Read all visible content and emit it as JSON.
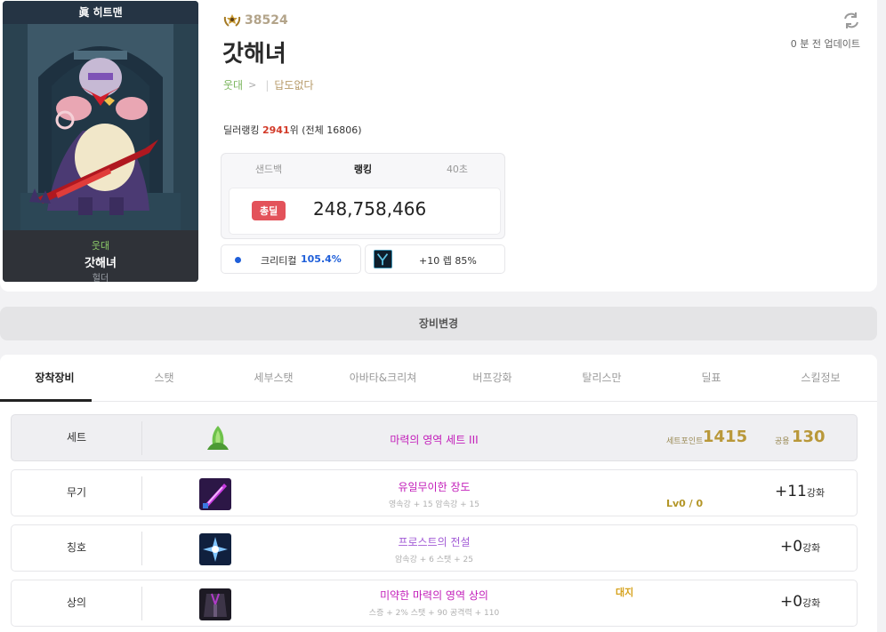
{
  "portrait": {
    "top_badge": "眞 히트맨",
    "adventure": "웃대",
    "name": "갓해녀",
    "job": "헐더"
  },
  "profile": {
    "fame": "38524",
    "name": "갓해녀",
    "adventure": "웃대",
    "guild": "답도없다",
    "update_text": "0 분 전 업데이트",
    "rank_label": "딜러랭킹",
    "rank_value": "2941",
    "rank_suffix": "위 (전체 16806)"
  },
  "stats": {
    "tabs": [
      "샌드백",
      "랭킹",
      "40초"
    ],
    "active_tab": "랭킹",
    "total_badge": "총딜",
    "total_damage": "248,758,466",
    "crit_label": "크리티컬",
    "crit_value": "105.4%",
    "weapon_level": "+10 렙 85%"
  },
  "gear_change_label": "장비변경",
  "main_tabs": [
    "장착장비",
    "스탯",
    "세부스탯",
    "아바타&크리쳐",
    "버프강화",
    "탈리스만",
    "딜표",
    "스킬정보"
  ],
  "equipment": [
    {
      "slot": "세트",
      "name": "마력의 영역 세트 III",
      "set_point_label": "세트포인트",
      "set_point_value": "1415",
      "common_label": "공용",
      "common_value": "130"
    },
    {
      "slot": "무기",
      "name": "유일무이한 장도",
      "sub": "영속강 + 15 암속강 + 15",
      "level": "Lv0 / 0",
      "reinforce": "+11",
      "reinforce_suffix": "강화"
    },
    {
      "slot": "칭호",
      "name": "프로스트의 전설",
      "sub": "암속강 + 6 스탯 + 25",
      "reinforce": "+0",
      "reinforce_suffix": "강화"
    },
    {
      "slot": "상의",
      "name": "미약한 마력의 영역 상의",
      "sub": "스증 + 2% 스탯 + 90 공격력 + 110",
      "tag": "대지",
      "reinforce": "+0",
      "reinforce_suffix": "강화"
    }
  ],
  "colors": {
    "item_name": "#c21cb9",
    "title_item_name": "#a25bd6",
    "damage_badge": "#e3525a",
    "crit_value": "#1f5fd9",
    "rank_highlight": "#d23a28",
    "set_gold": "#b9983a"
  },
  "icons": {
    "fame": "laurel-crest-icon",
    "refresh": "refresh-icon",
    "crit": "blue-dot-icon",
    "weapon": "weapon-thumbnail",
    "set": "green-leaf-set-icon",
    "weapon_item": "purple-blade-icon",
    "title_item": "ice-crystal-icon",
    "top_item": "dark-robe-icon"
  }
}
